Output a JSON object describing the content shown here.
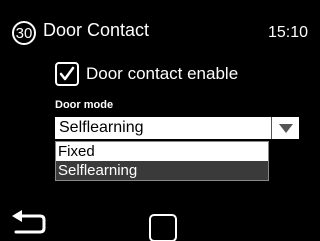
{
  "header": {
    "badge": "30",
    "title": "Door Contact",
    "time": "15:10"
  },
  "door_contact": {
    "checkbox_label": "Door contact enable",
    "checked": true
  },
  "door_mode": {
    "label": "Door mode",
    "selected": "Selflearning",
    "options": [
      "Fixed",
      "Selflearning"
    ],
    "highlighted_option": "Selflearning"
  },
  "footer": {
    "back_icon": "back-arrow-icon",
    "home_icon": "home-square-icon"
  }
}
